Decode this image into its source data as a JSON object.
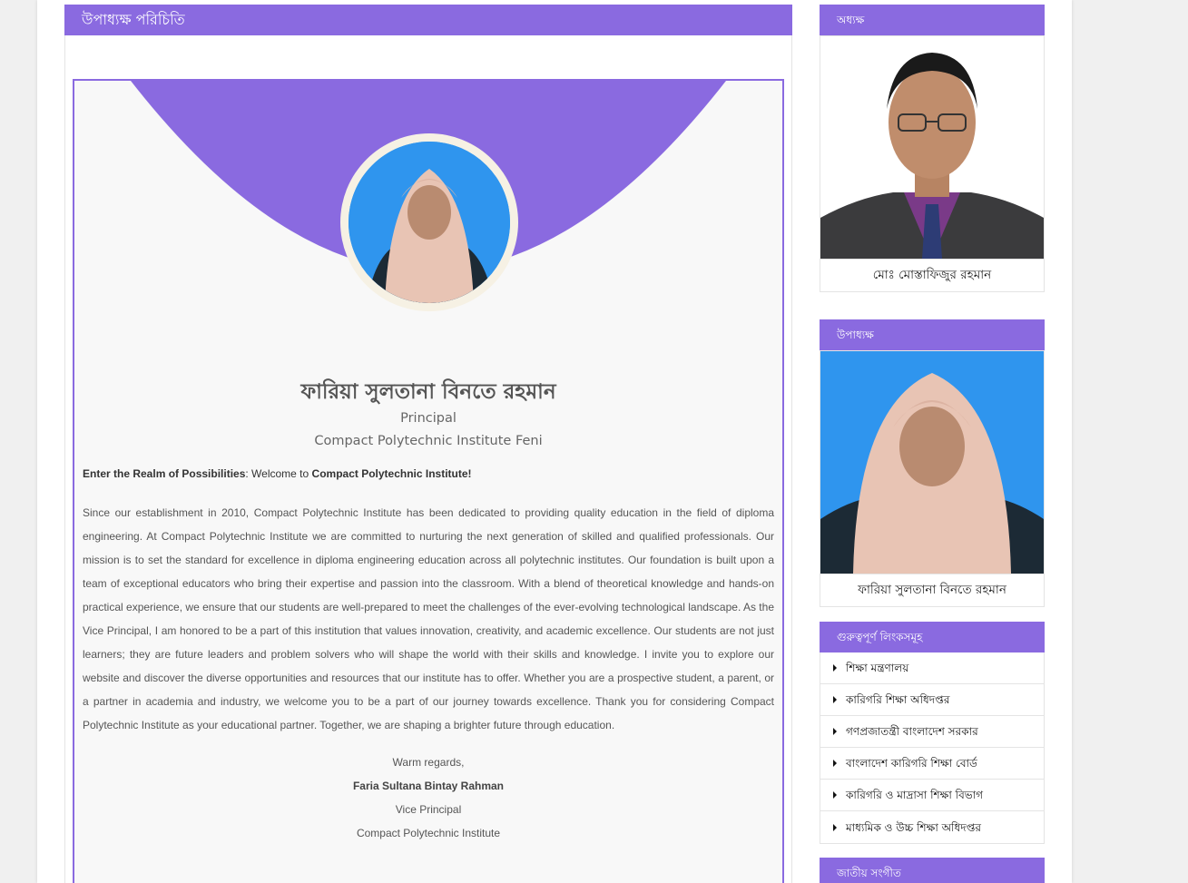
{
  "main": {
    "header": "উপাধ্যক্ষ পরিচিতি",
    "profile": {
      "name": "ফারিয়া সুলতানা বিনতে রহমান",
      "role": "Principal",
      "institute": "Compact Polytechnic Institute Feni"
    },
    "intro": {
      "lead_bold": "Enter the Realm of Possibilities",
      "lead_rest": ": Welcome to ",
      "inst_bold": "Compact Polytechnic Institute!"
    },
    "body": "Since our establishment in 2010, Compact Polytechnic Institute has been dedicated to providing quality education in the field of diploma engineering. At Compact Polytechnic Institute we are committed to nurturing the next generation of skilled and qualified professionals. Our mission is to set the standard for excellence in diploma engineering education across all polytechnic institutes. Our foundation is built upon a team of exceptional educators who bring their expertise and passion into the classroom. With a blend of theoretical knowledge and hands-on practical experience, we ensure that our students are well-prepared to meet the challenges of the ever-evolving technological landscape. As the Vice Principal, I am honored to be a part of this institution that values innovation, creativity, and academic excellence. Our students are not just learners; they are future leaders and problem solvers who will shape the world with their skills and knowledge. I invite you to explore our website and discover the diverse opportunities and resources that our institute has to offer. Whether you are a prospective student, a parent, or a partner in academia and industry, we welcome you to be a part of our journey towards excellence. Thank you for considering Compact Polytechnic Institute as your educational partner. Together, we are shaping a brighter future through education.",
    "signoff": {
      "regards": "Warm regards,",
      "name": "Faria Sultana Bintay Rahman",
      "title": "Vice Principal",
      "institute": "Compact Polytechnic Institute"
    }
  },
  "sidebar": {
    "principal": {
      "header": "অধ্যক্ষ",
      "name": "মোঃ মোস্তাফিজুর রহমান"
    },
    "vice_principal": {
      "header": "উপাধ্যক্ষ",
      "name": "ফারিয়া সুলতানা বিনতে রহমান"
    },
    "links": {
      "header": "গুরুত্বপূর্ণ লিংকসমূহ",
      "items": [
        "শিক্ষা মন্ত্রণালয়",
        "কারিগরি শিক্ষা অধিদপ্তর",
        "গণপ্রজাতন্ত্রী বাংলাদেশ সরকার",
        "বাংলাদেশ কারিগরি শিক্ষা বোর্ড",
        "কারিগরি ও মাদ্রাসা শিক্ষা বিভাগ",
        "মাধ্যমিক ও উচ্চ শিক্ষা অধিদপ্তর"
      ]
    },
    "anthem": {
      "header": "জাতীয় সংগীত"
    }
  },
  "colors": {
    "accent": "#8a6ae0",
    "photo_bg": "#2f95ee"
  }
}
